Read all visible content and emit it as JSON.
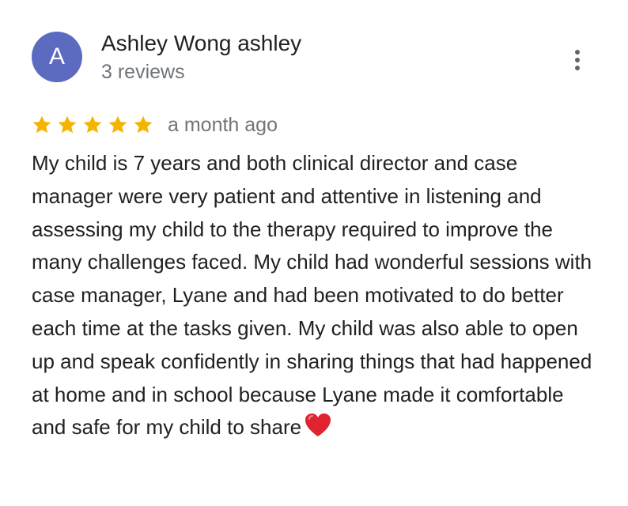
{
  "reviewer": {
    "avatar_initial": "A",
    "avatar_color": "#5c6bc0",
    "name": "Ashley Wong ashley",
    "review_count": "3 reviews"
  },
  "review": {
    "rating": 5,
    "rating_max": 5,
    "star_color": "#f4b400",
    "time_ago": "a month ago",
    "text": "My child is 7 years and both clinical director and case manager were very patient and attentive in listening and assessing my child to the therapy required to improve the many challenges faced. My child had wonderful sessions with case manager, Lyane and had been motivated to do better each time at the tasks given. My child was also able to open up and speak confidently in sharing things that had happened at home and in school because Lyane made it comfortable and safe for my child to share",
    "trailing_emoji": "red-heart-icon"
  },
  "menu": {
    "icon": "more-vertical-icon"
  }
}
